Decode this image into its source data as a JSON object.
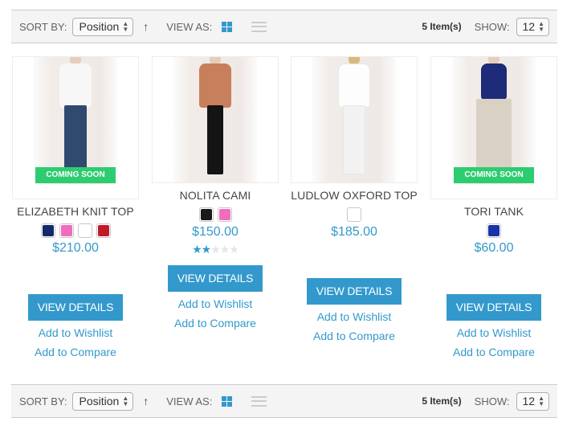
{
  "toolbar": {
    "sort_by_label": "SORT BY:",
    "sort_value": "Position",
    "sort_direction_icon": "arrow-up-icon",
    "view_as_label": "VIEW AS:",
    "view_modes": [
      {
        "name": "grid",
        "icon": "grid-icon",
        "active": true
      },
      {
        "name": "list",
        "icon": "list-icon",
        "active": false
      }
    ],
    "item_count": "5 Item(s)",
    "show_label": "SHOW:",
    "show_value": "12"
  },
  "colors": {
    "accent": "#3399cc",
    "coming_soon": "#2ecc71",
    "toolbar_bg": "#f4f4f4"
  },
  "products": [
    {
      "name": "ELIZABETH KNIT TOP",
      "price": "$210.00",
      "badge": "COMING SOON",
      "swatches": [
        "#13296b",
        "#f06cbe",
        "#ffffff",
        "#c01a2a"
      ],
      "rating": null,
      "top_color": "#f7f7f7",
      "bottom_color": "#2f4a6e",
      "view_details": "VIEW DETAILS",
      "add_to_wishlist": "Add to Wishlist",
      "add_to_compare": "Add to Compare"
    },
    {
      "name": "NOLITA CAMI",
      "price": "$150.00",
      "badge": null,
      "swatches": [
        "#1a1a1a",
        "#f06cbe"
      ],
      "rating": {
        "filled": 2,
        "total": 5
      },
      "top_color": "#c77f5c",
      "bottom_color": "#141414",
      "view_details": "VIEW DETAILS",
      "add_to_wishlist": "Add to Wishlist",
      "add_to_compare": "Add to Compare"
    },
    {
      "name": "LUDLOW OXFORD TOP",
      "price": "$185.00",
      "badge": null,
      "swatches": [
        "#ffffff"
      ],
      "rating": null,
      "top_color": "#fbfbfb",
      "bottom_color": "#f2f2f2",
      "view_details": "VIEW DETAILS",
      "add_to_wishlist": "Add to Wishlist",
      "add_to_compare": "Add to Compare"
    },
    {
      "name": "TORI TANK",
      "price": "$60.00",
      "badge": "COMING SOON",
      "swatches": [
        "#1a32a8"
      ],
      "rating": null,
      "top_color": "#1e2b78",
      "bottom_color": "#d9d1c3",
      "view_details": "VIEW DETAILS",
      "add_to_wishlist": "Add to Wishlist",
      "add_to_compare": "Add to Compare"
    }
  ]
}
